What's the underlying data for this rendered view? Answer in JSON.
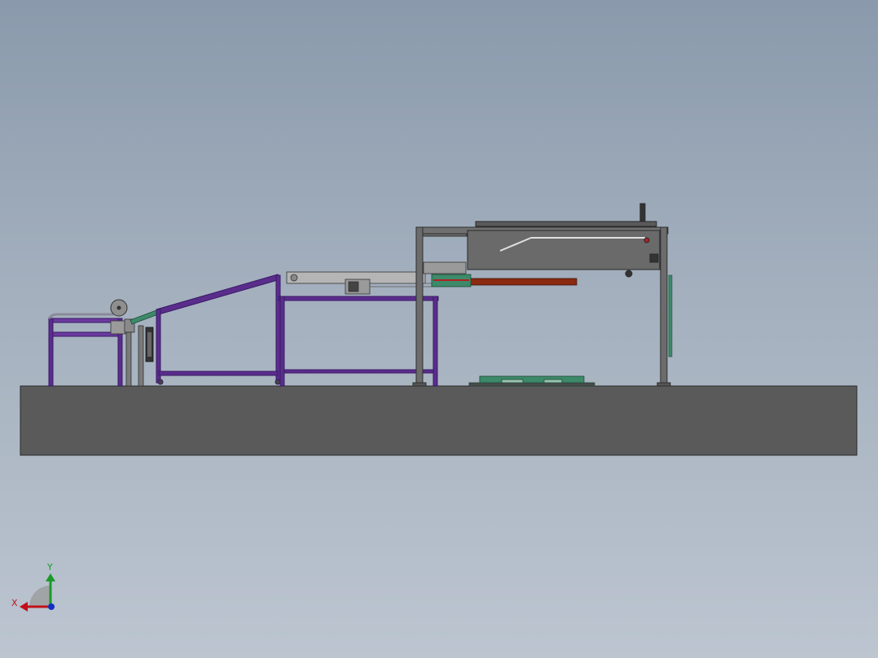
{
  "triad": {
    "x_label": "X",
    "y_label": "Y",
    "x_color": "#c0101a",
    "y_color": "#1a9a2a",
    "z_color": "#1030c0"
  },
  "colors": {
    "floor": "#5b5a5b",
    "frame_purple": "#5a2d8c",
    "frame_gray": "#6c6c6c",
    "housing": "#6a6a6a",
    "belt_red": "#8a2a10",
    "plate_green": "#3d8a6a",
    "conveyor_light": "#b5b5b5"
  }
}
